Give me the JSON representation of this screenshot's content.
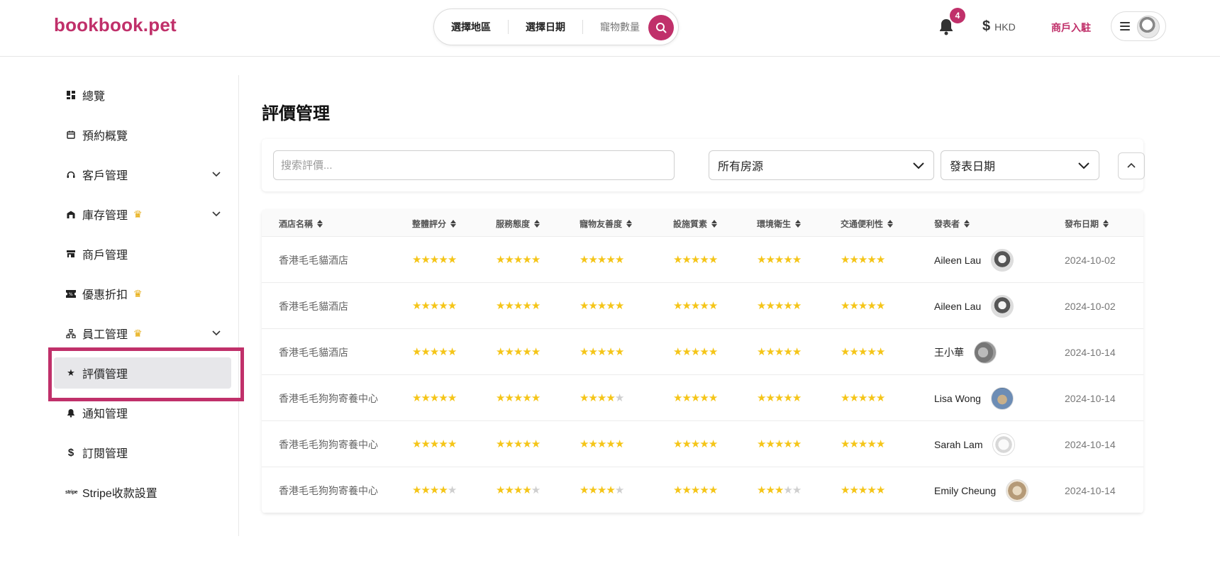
{
  "header": {
    "logo": "bookbook.pet",
    "search": {
      "region": "選擇地區",
      "date": "選擇日期",
      "pets": "寵物數量"
    },
    "notifications_count": "4",
    "currency_symbol": "$",
    "currency": "HKD",
    "merchant_link": "商戶入駐"
  },
  "sidebar": {
    "items": [
      {
        "label": "總覽",
        "icon": "dashboard-icon",
        "crown": false,
        "expandable": false
      },
      {
        "label": "預約概覽",
        "icon": "calendar-icon",
        "crown": false,
        "expandable": false
      },
      {
        "label": "客戶管理",
        "icon": "headset-icon",
        "crown": false,
        "expandable": true
      },
      {
        "label": "庫存管理",
        "icon": "warehouse-icon",
        "crown": true,
        "expandable": true
      },
      {
        "label": "商戶管理",
        "icon": "store-icon",
        "crown": false,
        "expandable": false
      },
      {
        "label": "優惠折扣",
        "icon": "ticket-icon",
        "crown": true,
        "expandable": false
      },
      {
        "label": "員工管理",
        "icon": "org-chart-icon",
        "crown": true,
        "expandable": true
      },
      {
        "label": "評價管理",
        "icon": "star-icon",
        "crown": false,
        "expandable": false,
        "active": true
      },
      {
        "label": "通知管理",
        "icon": "bell-icon",
        "crown": false,
        "expandable": false
      },
      {
        "label": "訂閱管理",
        "icon": "dollar-icon",
        "crown": false,
        "expandable": false
      },
      {
        "label": "Stripe收款設置",
        "icon": "stripe-icon",
        "icon_text": "stripe",
        "crown": false,
        "expandable": false
      }
    ]
  },
  "main": {
    "title": "評價管理",
    "filters": {
      "search_placeholder": "搜索評價...",
      "property_select": "所有房源",
      "date_select": "發表日期"
    },
    "table": {
      "columns": [
        "酒店名稱",
        "整體評分",
        "服務態度",
        "寵物友善度",
        "設施質素",
        "環境衛生",
        "交通便利性",
        "發表者",
        "發布日期"
      ],
      "rows": [
        {
          "hotel": "香港毛毛貓酒店",
          "ratings": [
            5,
            5,
            5,
            5,
            5,
            5
          ],
          "author": "Aileen Lau",
          "date": "2024-10-02"
        },
        {
          "hotel": "香港毛毛貓酒店",
          "ratings": [
            5,
            5,
            5,
            5,
            5,
            5
          ],
          "author": "Aileen Lau",
          "date": "2024-10-02"
        },
        {
          "hotel": "香港毛毛貓酒店",
          "ratings": [
            5,
            5,
            5,
            5,
            5,
            5
          ],
          "author": "王小華",
          "date": "2024-10-14"
        },
        {
          "hotel": "香港毛毛狗狗寄養中心",
          "ratings": [
            5,
            5,
            4,
            5,
            5,
            5
          ],
          "author": "Lisa Wong",
          "date": "2024-10-14"
        },
        {
          "hotel": "香港毛毛狗狗寄養中心",
          "ratings": [
            5,
            5,
            5,
            5,
            5,
            5
          ],
          "author": "Sarah Lam",
          "date": "2024-10-14"
        },
        {
          "hotel": "香港毛毛狗狗寄養中心",
          "ratings": [
            4,
            4,
            4,
            5,
            3,
            5
          ],
          "author": "Emily Cheung",
          "date": "2024-10-14"
        }
      ]
    }
  },
  "colors": {
    "brand": "#c0306a",
    "star": "#f5c518",
    "crown": "#e5a700"
  }
}
